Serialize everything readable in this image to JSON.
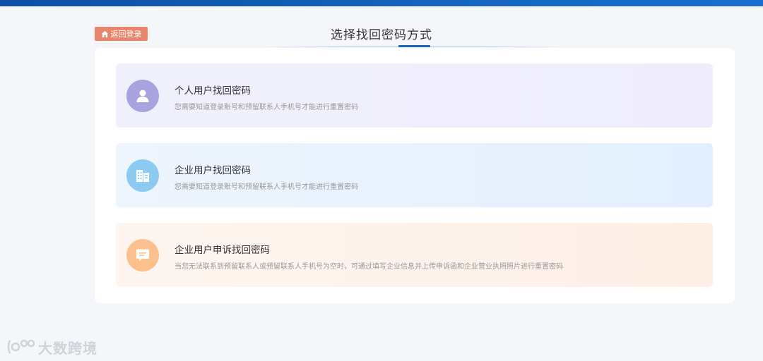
{
  "header": {
    "back_label": "返回登录",
    "title": "选择找回密码方式"
  },
  "options": [
    {
      "title": "个人用户找回密码",
      "desc": "您需要知道登录账号和预留联系人手机号才能进行重置密码",
      "icon": "user-icon",
      "color": "#a9a3e0"
    },
    {
      "title": "企业用户找回密码",
      "desc": "您需要知道登录账号和预留联系人手机号才能进行重置密码",
      "icon": "building-icon",
      "color": "#8ccaf1"
    },
    {
      "title": "企业用户申诉找回密码",
      "desc": "当您无法联系到预留联系人或预留联系人手机号为空时，可通过填写企业信息并上传申诉函和企业营业执照照片进行重置密码",
      "icon": "message-icon",
      "color": "#fcc08c"
    }
  ],
  "watermark": {
    "text": "大数跨境"
  },
  "colors": {
    "accent": "#1565c0",
    "back_button": "#e8866d"
  }
}
